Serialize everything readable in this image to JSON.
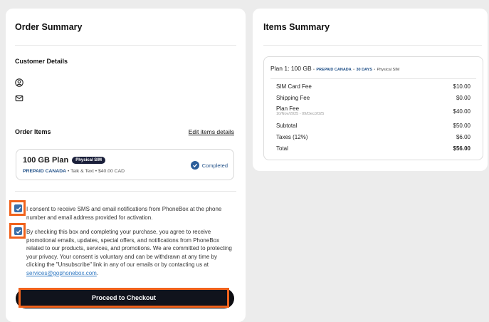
{
  "order_summary": {
    "title": "Order Summary",
    "customer_details_label": "Customer Details",
    "order_items_label": "Order Items",
    "edit_items_link": "Edit items details",
    "plan": {
      "name": "100 GB Plan",
      "badge": "Physical SIM",
      "brand": "PREPAID CANADA",
      "details": "• Talk & Text • $40.00 CAD",
      "status": "Completed"
    },
    "consents": [
      {
        "checked": true,
        "text": "I consent to receive SMS and email notifications from PhoneBox at the phone number and email address provided for activation."
      },
      {
        "checked": true,
        "text_before": "By checking this box and completing your purchase, you agree to receive promotional emails, updates, special offers, and notifications from PhoneBox related to our products, services, and promotions. We are committed to protecting your privacy. Your consent is voluntary and can be withdrawn at any time by clicking the \"Unsubscribe\" link in any of our emails or by contacting us at ",
        "email": "services@gophonebox.com",
        "text_after": "."
      }
    ],
    "checkout_label": "Proceed to Checkout"
  },
  "items_summary": {
    "title": "Items Summary",
    "plan_line": {
      "label": "Plan 1: 100 GB",
      "brand": "PREPAID CANADA",
      "days": "30 DAYS",
      "sim": "Physical SIM"
    },
    "rows": [
      {
        "label": "SIM Card Fee",
        "value": "$10.00"
      },
      {
        "label": "Shipping Fee",
        "value": "$0.00"
      },
      {
        "label": "Plan Fee",
        "sub": "10/Nov/2025 - 09/Dec/2025",
        "value": "$40.00"
      },
      {
        "label": "Subtotal",
        "value": "$50.00"
      },
      {
        "label": "Taxes (12%)",
        "value": "$6.00"
      },
      {
        "label": "Total",
        "value": "$56.00",
        "bold": true
      }
    ]
  },
  "colors": {
    "accent": "#f0621c",
    "brand": "#1f4f87",
    "checkbox": "#3a6ea8"
  }
}
